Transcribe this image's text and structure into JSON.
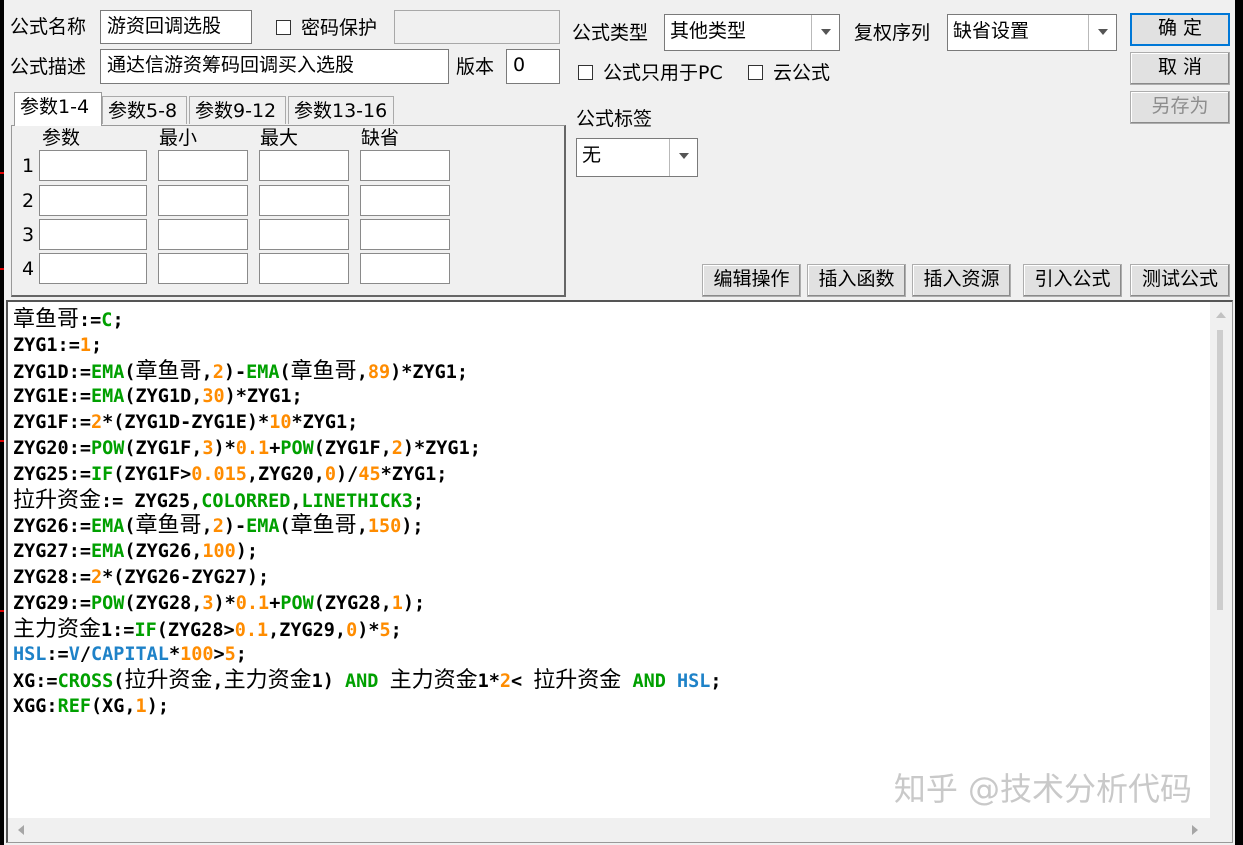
{
  "header": {
    "name_label": "公式名称",
    "name_value": "游资回调选股",
    "password_label": "密码保护",
    "password_value": "",
    "desc_label": "公式描述",
    "desc_value": "通达信游资筹码回调买入选股",
    "version_label": "版本",
    "version_value": "0",
    "type_label": "公式类型",
    "type_value": "其他类型",
    "rights_label": "复权序列",
    "rights_value": "缺省设置",
    "pc_only_label": "公式只用于PC",
    "cloud_label": "云公式",
    "tag_label": "公式标签",
    "tag_value": "无"
  },
  "buttons": {
    "ok": "确  定",
    "cancel": "取  消",
    "save_as": "另存为",
    "edit_ops": "编辑操作",
    "insert_func": "插入函数",
    "insert_res": "插入资源",
    "import_formula": "引入公式",
    "test_formula": "测试公式"
  },
  "tabs": [
    "参数1-4",
    "参数5-8",
    "参数9-12",
    "参数13-16"
  ],
  "params": {
    "headers": [
      "参数",
      "最小",
      "最大",
      "缺省"
    ],
    "rows": [
      "1",
      "2",
      "3",
      "4"
    ]
  },
  "code_lines": [
    [
      [
        "c",
        "章鱼哥"
      ],
      [
        "t",
        ":="
      ],
      [
        "f",
        "C"
      ],
      [
        "t",
        ";"
      ]
    ],
    [
      [
        "t",
        "ZYG1:="
      ],
      [
        "n",
        "1"
      ],
      [
        "t",
        ";"
      ]
    ],
    [
      [
        "t",
        "ZYG1D:="
      ],
      [
        "f",
        "EMA"
      ],
      [
        "t",
        "("
      ],
      [
        "c",
        "章鱼哥"
      ],
      [
        "t",
        ","
      ],
      [
        "n",
        "2"
      ],
      [
        "t",
        ")-"
      ],
      [
        "f",
        "EMA"
      ],
      [
        "t",
        "("
      ],
      [
        "c",
        "章鱼哥"
      ],
      [
        "t",
        ","
      ],
      [
        "n",
        "89"
      ],
      [
        "t",
        ")*ZYG1;"
      ]
    ],
    [
      [
        "t",
        "ZYG1E:="
      ],
      [
        "f",
        "EMA"
      ],
      [
        "t",
        "(ZYG1D,"
      ],
      [
        "n",
        "30"
      ],
      [
        "t",
        ")*ZYG1;"
      ]
    ],
    [
      [
        "t",
        "ZYG1F:="
      ],
      [
        "n",
        "2"
      ],
      [
        "t",
        "*(ZYG1D-ZYG1E)*"
      ],
      [
        "n",
        "10"
      ],
      [
        "t",
        "*ZYG1;"
      ]
    ],
    [
      [
        "t",
        "ZYG20:="
      ],
      [
        "f",
        "POW"
      ],
      [
        "t",
        "(ZYG1F,"
      ],
      [
        "n",
        "3"
      ],
      [
        "t",
        ")*"
      ],
      [
        "n",
        "0.1"
      ],
      [
        "t",
        "+"
      ],
      [
        "f",
        "POW"
      ],
      [
        "t",
        "(ZYG1F,"
      ],
      [
        "n",
        "2"
      ],
      [
        "t",
        ")*ZYG1;"
      ]
    ],
    [
      [
        "t",
        "ZYG25:="
      ],
      [
        "f",
        "IF"
      ],
      [
        "t",
        "(ZYG1F>"
      ],
      [
        "n",
        "0.015"
      ],
      [
        "t",
        ",ZYG20,"
      ],
      [
        "n",
        "0"
      ],
      [
        "t",
        ")/"
      ],
      [
        "n",
        "45"
      ],
      [
        "t",
        "*ZYG1;"
      ]
    ],
    [
      [
        "c",
        "拉升资金"
      ],
      [
        "t",
        ":= ZYG25,"
      ],
      [
        "f",
        "COLORRED"
      ],
      [
        "t",
        ","
      ],
      [
        "f",
        "LINETHICK3"
      ],
      [
        "t",
        ";"
      ]
    ],
    [
      [
        "t",
        "ZYG26:="
      ],
      [
        "f",
        "EMA"
      ],
      [
        "t",
        "("
      ],
      [
        "c",
        "章鱼哥"
      ],
      [
        "t",
        ","
      ],
      [
        "n",
        "2"
      ],
      [
        "t",
        ")-"
      ],
      [
        "f",
        "EMA"
      ],
      [
        "t",
        "("
      ],
      [
        "c",
        "章鱼哥"
      ],
      [
        "t",
        ","
      ],
      [
        "n",
        "150"
      ],
      [
        "t",
        ");"
      ]
    ],
    [
      [
        "t",
        "ZYG27:="
      ],
      [
        "f",
        "EMA"
      ],
      [
        "t",
        "(ZYG26,"
      ],
      [
        "n",
        "100"
      ],
      [
        "t",
        ");"
      ]
    ],
    [
      [
        "t",
        "ZYG28:="
      ],
      [
        "n",
        "2"
      ],
      [
        "t",
        "*(ZYG26-ZYG27);"
      ]
    ],
    [
      [
        "t",
        "ZYG29:="
      ],
      [
        "f",
        "POW"
      ],
      [
        "t",
        "(ZYG28,"
      ],
      [
        "n",
        "3"
      ],
      [
        "t",
        ")*"
      ],
      [
        "n",
        "0.1"
      ],
      [
        "t",
        "+"
      ],
      [
        "f",
        "POW"
      ],
      [
        "t",
        "(ZYG28,"
      ],
      [
        "n",
        "1"
      ],
      [
        "t",
        ");"
      ]
    ],
    [
      [
        "c",
        "主力资金"
      ],
      [
        "t",
        "1:="
      ],
      [
        "f",
        "IF"
      ],
      [
        "t",
        "(ZYG28>"
      ],
      [
        "n",
        "0.1"
      ],
      [
        "t",
        ",ZYG29,"
      ],
      [
        "n",
        "0"
      ],
      [
        "t",
        ")*"
      ],
      [
        "n",
        "5"
      ],
      [
        "t",
        ";"
      ]
    ],
    [
      [
        "s",
        "HSL"
      ],
      [
        "t",
        ":="
      ],
      [
        "s",
        "V"
      ],
      [
        "t",
        "/"
      ],
      [
        "s",
        "CAPITAL"
      ],
      [
        "t",
        "*"
      ],
      [
        "n",
        "100"
      ],
      [
        "t",
        ">"
      ],
      [
        "n",
        "5"
      ],
      [
        "t",
        ";"
      ]
    ],
    [
      [
        "t",
        "XG:="
      ],
      [
        "f",
        "CROSS"
      ],
      [
        "t",
        "("
      ],
      [
        "c",
        "拉升资金"
      ],
      [
        "t",
        ","
      ],
      [
        "c",
        "主力资金"
      ],
      [
        "t",
        "1) "
      ],
      [
        "f",
        "AND"
      ],
      [
        "t",
        " "
      ],
      [
        "c",
        "主力资金"
      ],
      [
        "t",
        "1*"
      ],
      [
        "n",
        "2"
      ],
      [
        "t",
        "< "
      ],
      [
        "c",
        "拉升资金"
      ],
      [
        "t",
        " "
      ],
      [
        "f",
        "AND"
      ],
      [
        "t",
        " "
      ],
      [
        "s",
        "HSL"
      ],
      [
        "t",
        ";"
      ]
    ],
    [
      [
        "t",
        "XGG:"
      ],
      [
        "f",
        "REF"
      ],
      [
        "t",
        "(XG,"
      ],
      [
        "n",
        "1"
      ],
      [
        "t",
        ");"
      ]
    ]
  ],
  "watermark": "知乎 @技术分析代码"
}
